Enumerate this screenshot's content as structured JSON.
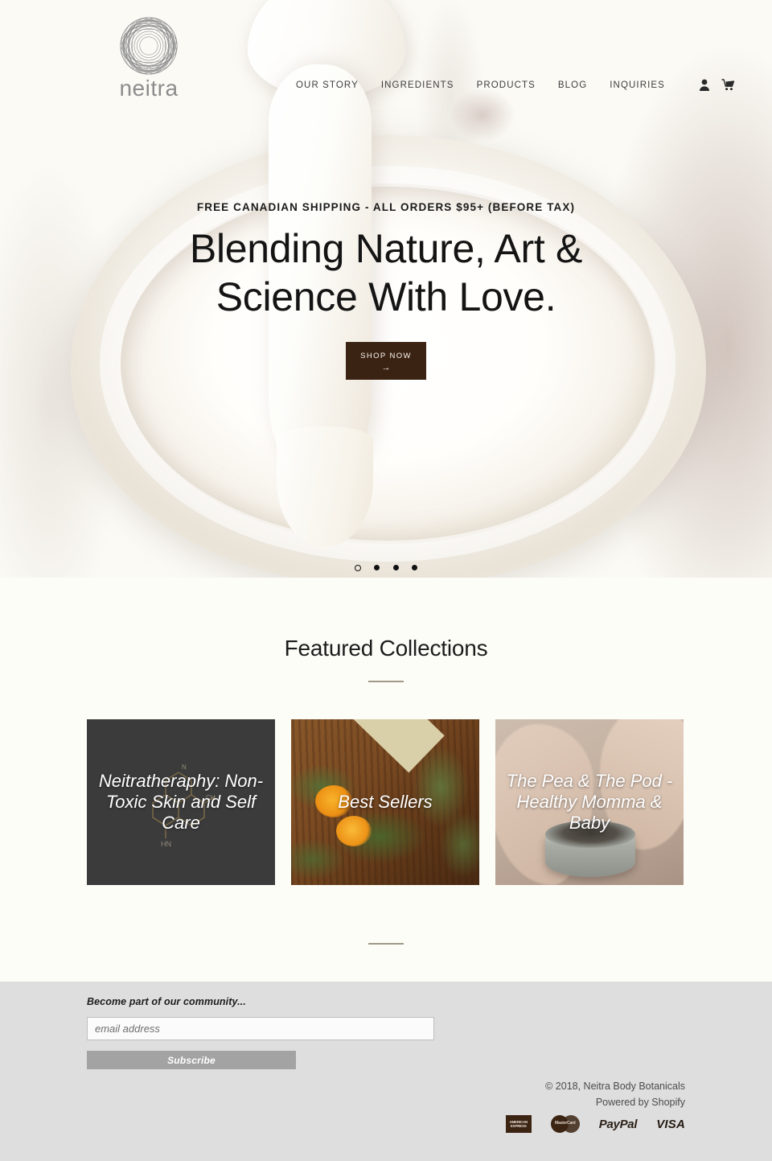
{
  "brand": {
    "name": "neitra",
    "logo_icon": "mandala-circle-logo"
  },
  "nav": {
    "items": [
      {
        "label": "OUR STORY"
      },
      {
        "label": "INGREDIENTS"
      },
      {
        "label": "PRODUCTS"
      },
      {
        "label": "BLOG"
      },
      {
        "label": "INQUIRIES"
      }
    ],
    "account_icon": "user-account-icon",
    "cart_icon": "shopping-cart-icon"
  },
  "hero": {
    "kicker": "FREE CANADIAN SHIPPING - ALL ORDERS $95+ (BEFORE TAX)",
    "title_line1": "Blending Nature, Art &",
    "title_line2": "Science With Love.",
    "cta_label": "SHOP NOW",
    "cta_arrow": "→",
    "cta_bg": "#3a2313",
    "slides_total": 4,
    "active_slide": 1
  },
  "featured": {
    "title": "Featured Collections",
    "cards": [
      {
        "label": "Neitratheraphy: Non-Toxic Skin and Self Care",
        "bg": "#3b3b3b"
      },
      {
        "label": "Best Sellers",
        "bg": "#7a4a22"
      },
      {
        "label": "The Pea & The Pod - Healthy Momma & Baby",
        "bg": "#b6a192"
      }
    ]
  },
  "footer": {
    "newsletter_heading": "Become part of our community...",
    "email_placeholder": "email address",
    "email_value": "",
    "subscribe_label": "Subscribe",
    "copyright": "© 2018, Neitra Body Botanicals",
    "powered_by": "Powered by Shopify",
    "bg": "#dedede",
    "payments": [
      {
        "name": "american-express",
        "label": "AMERICAN EXPRESS"
      },
      {
        "name": "mastercard",
        "label": "MasterCard"
      },
      {
        "name": "paypal",
        "label": "PayPal"
      },
      {
        "name": "visa",
        "label": "VISA"
      }
    ]
  }
}
